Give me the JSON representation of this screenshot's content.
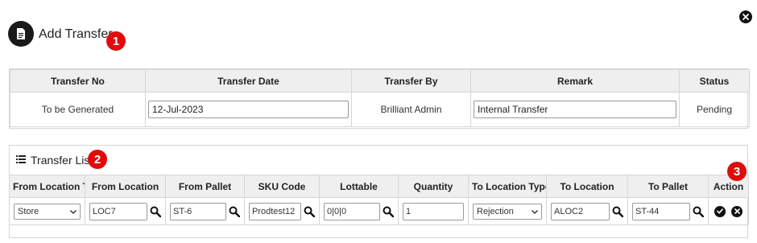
{
  "header": {
    "title": "Add Transfer",
    "badges": {
      "one": "1",
      "two": "2",
      "three": "3"
    }
  },
  "transfer": {
    "columns": [
      "Transfer No",
      "Transfer Date",
      "Transfer By",
      "Remark",
      "Status"
    ],
    "transfer_no": "To be Generated",
    "transfer_date": "12-Jul-2023",
    "transfer_by": "Brilliant Admin",
    "remark": "Internal Transfer",
    "status": "Pending"
  },
  "list": {
    "title": "Transfer List",
    "columns": [
      "From Location Type",
      "From Location",
      "From Pallet",
      "SKU Code",
      "Lottable",
      "Quantity",
      "To Location Type",
      "To Location",
      "To Pallet",
      "Action"
    ],
    "row": {
      "from_location_type": "Store",
      "from_location": "LOC7",
      "from_pallet": "ST-6",
      "sku_code": "Prodtest12",
      "lottable": "0|0|0",
      "quantity": "1",
      "to_location_type": "Rejection",
      "to_location": "ALOC2",
      "to_pallet": "ST-44"
    }
  },
  "colors": {
    "accent_badge": "#e10b0b",
    "header_bg": "#efefef",
    "border": "#d6d6d6"
  }
}
